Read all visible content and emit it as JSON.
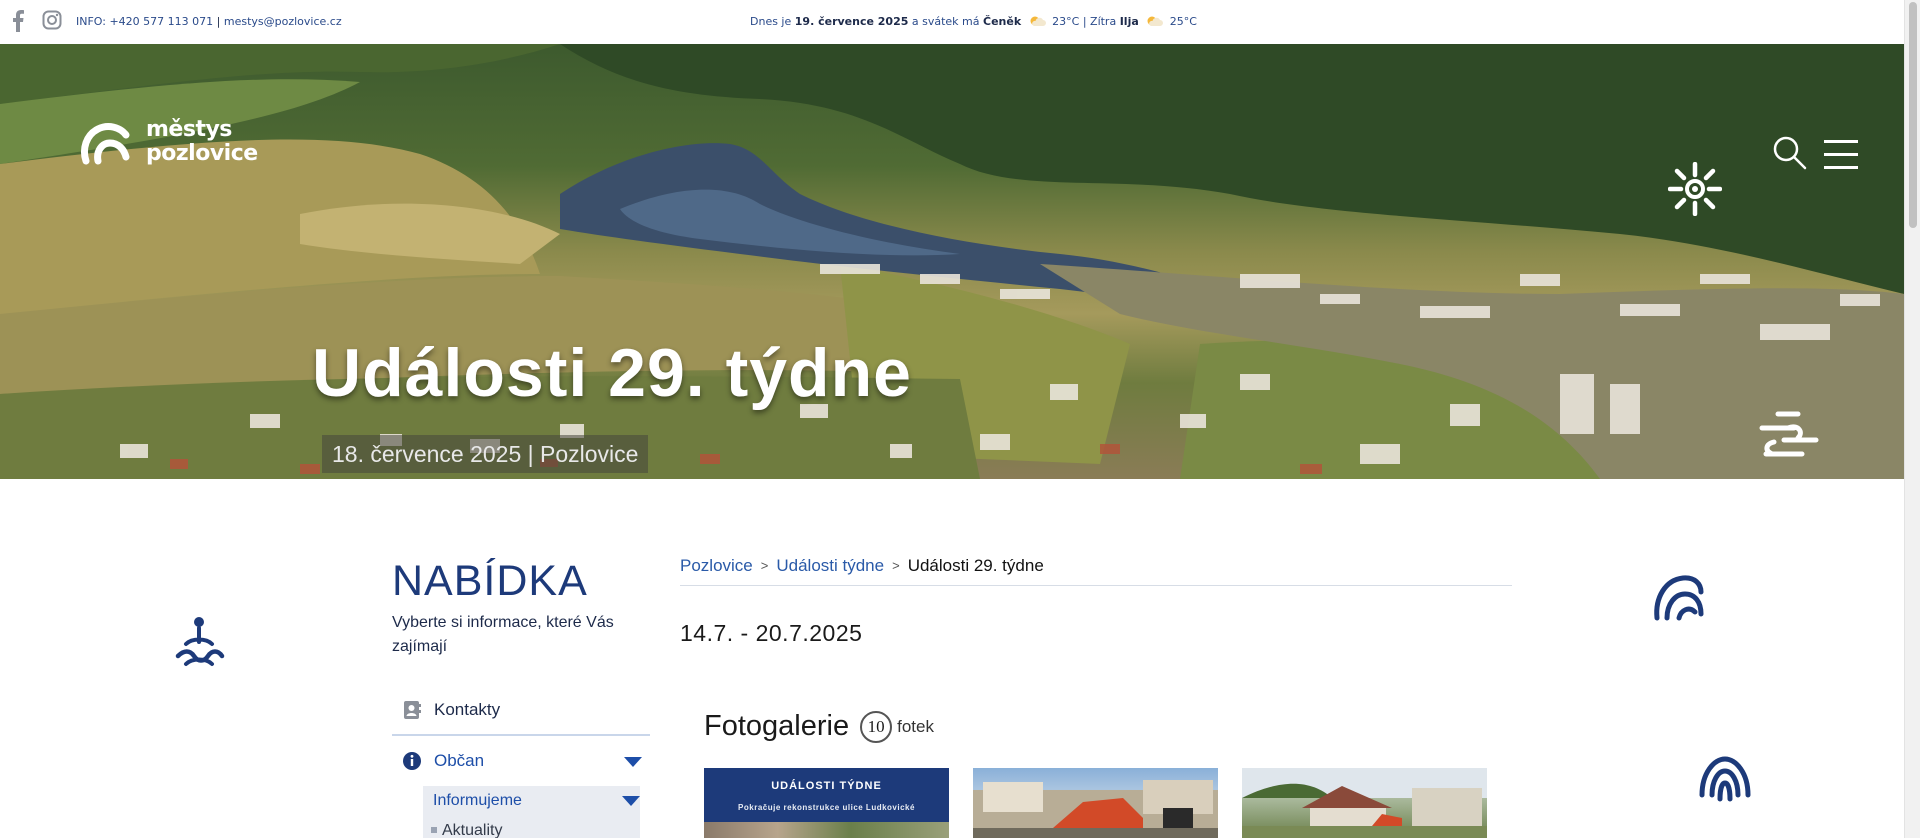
{
  "topbar": {
    "info_text": "INFO: +420 577 113 071",
    "separator": "|",
    "email": "mestys@pozlovice.cz",
    "today_prefix": "Dnes je",
    "today_date": "19. července 2025",
    "today_mid": "a svátek má",
    "today_name": "Čeněk",
    "today_temp": "23°C",
    "today_sep": "| Zítra",
    "tomorrow_name": "Ilja",
    "tomorrow_temp": "25°C"
  },
  "logo": {
    "line1": "městys",
    "line2": "pozlovice"
  },
  "hero": {
    "title": "Události 29. týdne",
    "subtitle": "18. července 2025 | Pozlovice"
  },
  "sidebar": {
    "heading": "NABÍDKA",
    "lead": "Vyberte si informace, které Vás zajímají",
    "items": [
      {
        "label": "Kontakty",
        "icon": "contacts-icon"
      },
      {
        "label": "Občan",
        "icon": "info-icon"
      }
    ],
    "submenu": {
      "label": "Informujeme",
      "leaf": "Aktuality"
    }
  },
  "breadcrumb": {
    "home": "Pozlovice",
    "sep": ">",
    "section": "Události týdne",
    "current": "Události 29. týdne"
  },
  "main": {
    "date_range": "14.7. - 20.7.2025"
  },
  "gallery": {
    "title": "Fotogalerie",
    "count": "10",
    "unit": "fotek",
    "thumb1_title": "UDÁLOSTI TÝDNE",
    "thumb1_sub": "Pokračuje rekonstrukce ulice Ludkovické"
  },
  "colors": {
    "brand_blue": "#1d3a7a",
    "link_blue": "#2a5aa8",
    "accent_blue": "#1d4ea8"
  }
}
